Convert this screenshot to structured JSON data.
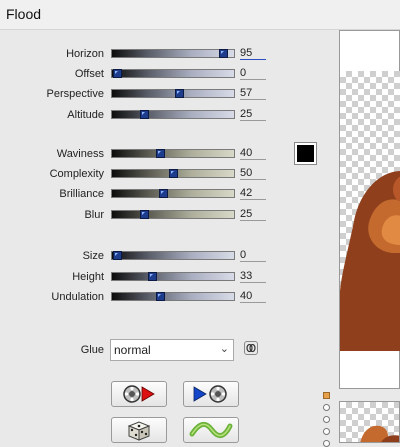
{
  "window": {
    "title": "Flood"
  },
  "group1": [
    {
      "label": "Horizon",
      "value": "95",
      "scheme": "blue",
      "level": 0.91
    },
    {
      "label": "Offset",
      "value": "0",
      "scheme": "blue",
      "level": 0.04
    },
    {
      "label": "Perspective",
      "value": "57",
      "scheme": "blue",
      "level": 0.55
    },
    {
      "label": "Altitude",
      "value": "25",
      "scheme": "blue",
      "level": 0.26
    }
  ],
  "group2": [
    {
      "label": "Waviness",
      "value": "40",
      "scheme": "tan",
      "level": 0.39
    },
    {
      "label": "Complexity",
      "value": "50",
      "scheme": "tan",
      "level": 0.5
    },
    {
      "label": "Brilliance",
      "value": "42",
      "scheme": "tan",
      "level": 0.42
    },
    {
      "label": "Blur",
      "value": "25",
      "scheme": "tan",
      "level": 0.26
    }
  ],
  "group3": [
    {
      "label": "Size",
      "value": "0",
      "scheme": "blue",
      "level": 0.04
    },
    {
      "label": "Height",
      "value": "33",
      "scheme": "blue",
      "level": 0.33
    },
    {
      "label": "Undulation",
      "value": "40",
      "scheme": "blue",
      "level": 0.39
    }
  ],
  "color_swatch": "#000000",
  "glue": {
    "label": "Glue",
    "value": "normal"
  },
  "icons": {
    "button1": "film-reel-play-icon",
    "button2": "play-film-reel-icon",
    "button3": "dice-icon",
    "button4": "wave-icon",
    "link": "link-icon"
  },
  "colors": {
    "thumb": "#1d3d8c",
    "preview_brown": "#9a4a1f"
  }
}
